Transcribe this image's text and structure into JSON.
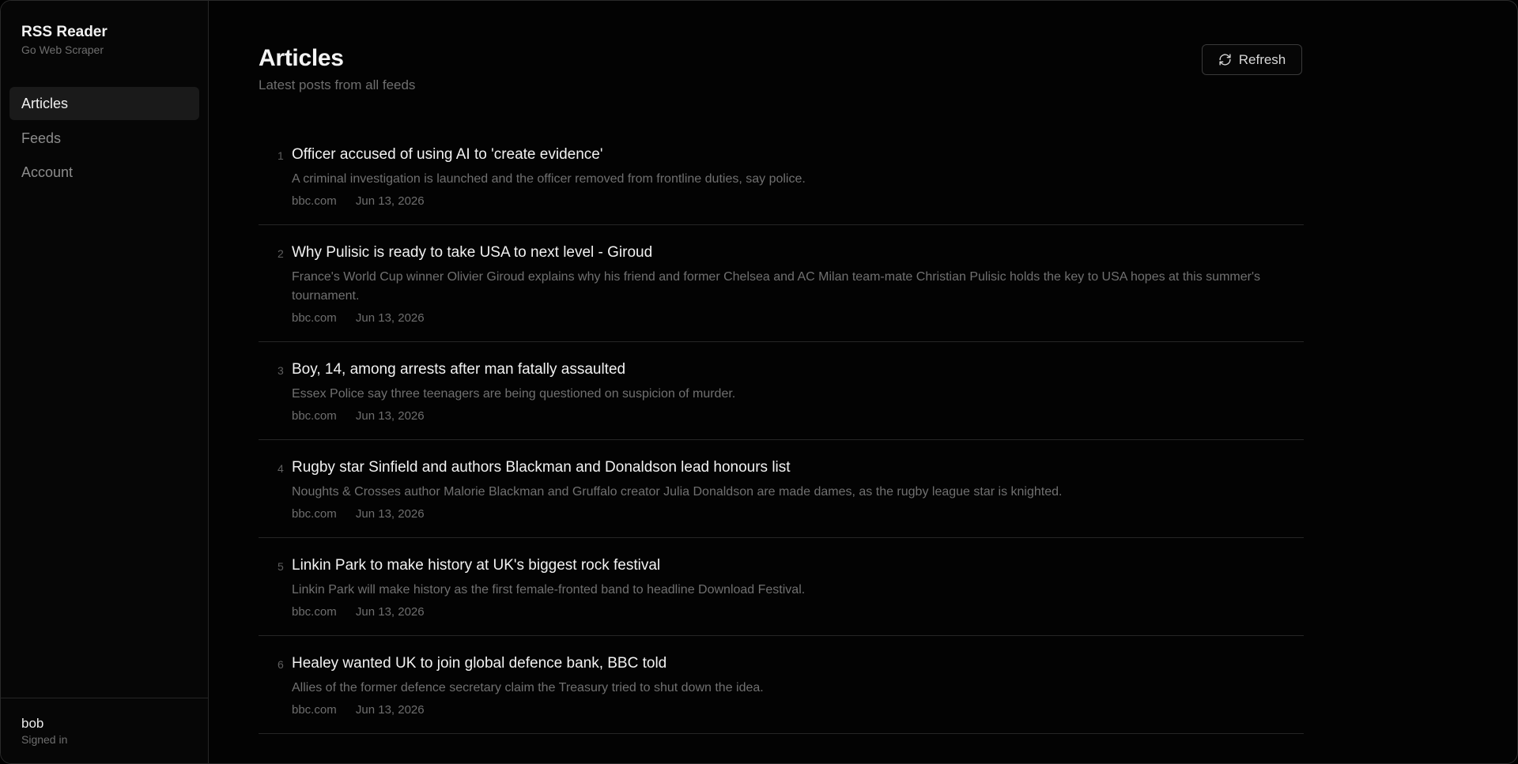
{
  "app": {
    "title": "RSS Reader",
    "subtitle": "Go Web Scraper"
  },
  "sidebar": {
    "items": [
      {
        "label": "Articles",
        "active": true
      },
      {
        "label": "Feeds",
        "active": false
      },
      {
        "label": "Account",
        "active": false
      }
    ],
    "user": {
      "name": "bob",
      "status": "Signed in"
    }
  },
  "page": {
    "title": "Articles",
    "subtitle": "Latest posts from all feeds",
    "refresh_label": "Refresh",
    "refresh_icon": "refresh-icon"
  },
  "articles": [
    {
      "index": "1",
      "title": "Officer accused of using AI to 'create evidence'",
      "description": "A criminal investigation is launched and the officer removed from frontline duties, say police.",
      "source": "bbc.com",
      "date": "Jun 13, 2026"
    },
    {
      "index": "2",
      "title": "Why Pulisic is ready to take USA to next level - Giroud",
      "description": "France's World Cup winner Olivier Giroud explains why his friend and former Chelsea and AC Milan team-mate Christian Pulisic holds the key to USA hopes at this summer's tournament.",
      "source": "bbc.com",
      "date": "Jun 13, 2026"
    },
    {
      "index": "3",
      "title": "Boy, 14, among arrests after man fatally assaulted",
      "description": "Essex Police say three teenagers are being questioned on suspicion of murder.",
      "source": "bbc.com",
      "date": "Jun 13, 2026"
    },
    {
      "index": "4",
      "title": "Rugby star Sinfield and authors Blackman and Donaldson lead honours list",
      "description": "Noughts & Crosses author Malorie Blackman and Gruffalo creator Julia Donaldson are made dames, as the rugby league star is knighted.",
      "source": "bbc.com",
      "date": "Jun 13, 2026"
    },
    {
      "index": "5",
      "title": "Linkin Park to make history at UK's biggest rock festival",
      "description": "Linkin Park will make history as the first female-fronted band to headline Download Festival.",
      "source": "bbc.com",
      "date": "Jun 13, 2026"
    },
    {
      "index": "6",
      "title": "Healey wanted UK to join global defence bank, BBC told",
      "description": "Allies of the former defence secretary claim the Treasury tried to shut down the idea.",
      "source": "bbc.com",
      "date": "Jun 13, 2026"
    }
  ]
}
